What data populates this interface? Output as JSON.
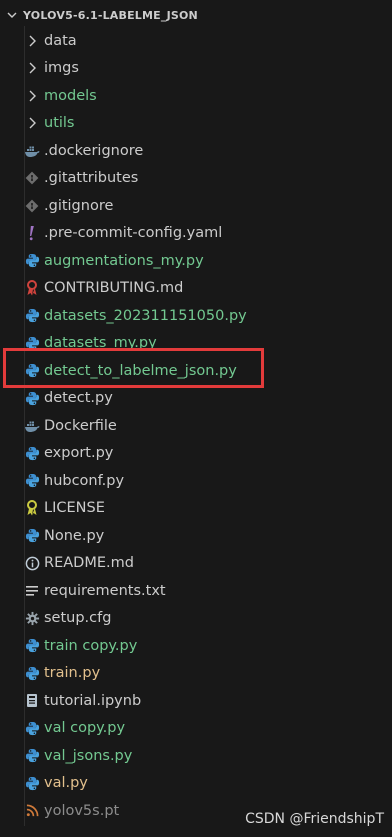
{
  "explorer": {
    "title": "YOLOV5-6.1-LABELME_JSON",
    "items": [
      {
        "label": "data",
        "type": "folder",
        "color": "#cccccc",
        "icon": "chevron-right-icon"
      },
      {
        "label": "imgs",
        "type": "folder",
        "color": "#cccccc",
        "icon": "chevron-right-icon"
      },
      {
        "label": "models",
        "type": "folder",
        "color": "#73c991",
        "icon": "chevron-right-icon"
      },
      {
        "label": "utils",
        "type": "folder",
        "color": "#73c991",
        "icon": "chevron-right-icon"
      },
      {
        "label": ".dockerignore",
        "type": "file",
        "color": "#cccccc",
        "icon": "docker-icon"
      },
      {
        "label": ".gitattributes",
        "type": "file",
        "color": "#cccccc",
        "icon": "git-icon"
      },
      {
        "label": ".gitignore",
        "type": "file",
        "color": "#cccccc",
        "icon": "git-icon"
      },
      {
        "label": ".pre-commit-config.yaml",
        "type": "file",
        "color": "#cccccc",
        "icon": "exclamation-icon"
      },
      {
        "label": "augmentations_my.py",
        "type": "file",
        "color": "#73c991",
        "icon": "python-icon"
      },
      {
        "label": "CONTRIBUTING.md",
        "type": "file",
        "color": "#cccccc",
        "icon": "ribbon-icon"
      },
      {
        "label": "datasets_202311151050.py",
        "type": "file",
        "color": "#73c991",
        "icon": "python-icon"
      },
      {
        "label": "datasets_my.py",
        "type": "file",
        "color": "#73c991",
        "icon": "python-icon"
      },
      {
        "label": "detect_to_labelme_json.py",
        "type": "file",
        "color": "#73c991",
        "icon": "python-icon",
        "highlighted": true
      },
      {
        "label": "detect.py",
        "type": "file",
        "color": "#cccccc",
        "icon": "python-icon"
      },
      {
        "label": "Dockerfile",
        "type": "file",
        "color": "#cccccc",
        "icon": "docker-icon"
      },
      {
        "label": "export.py",
        "type": "file",
        "color": "#cccccc",
        "icon": "python-icon"
      },
      {
        "label": "hubconf.py",
        "type": "file",
        "color": "#cccccc",
        "icon": "python-icon"
      },
      {
        "label": "LICENSE",
        "type": "file",
        "color": "#cccccc",
        "icon": "license-icon"
      },
      {
        "label": "None.py",
        "type": "file",
        "color": "#cccccc",
        "icon": "python-icon"
      },
      {
        "label": "README.md",
        "type": "file",
        "color": "#cccccc",
        "icon": "info-icon"
      },
      {
        "label": "requirements.txt",
        "type": "file",
        "color": "#cccccc",
        "icon": "lines-icon"
      },
      {
        "label": "setup.cfg",
        "type": "file",
        "color": "#cccccc",
        "icon": "gear-icon"
      },
      {
        "label": "train copy.py",
        "type": "file",
        "color": "#73c991",
        "icon": "python-icon"
      },
      {
        "label": "train.py",
        "type": "file",
        "color": "#e2c08d",
        "icon": "python-icon"
      },
      {
        "label": "tutorial.ipynb",
        "type": "file",
        "color": "#cccccc",
        "icon": "notebook-icon"
      },
      {
        "label": "val copy.py",
        "type": "file",
        "color": "#73c991",
        "icon": "python-icon"
      },
      {
        "label": "val_jsons.py",
        "type": "file",
        "color": "#73c991",
        "icon": "python-icon"
      },
      {
        "label": "val.py",
        "type": "file",
        "color": "#e2c08d",
        "icon": "python-icon"
      },
      {
        "label": "yolov5s.pt",
        "type": "file",
        "color": "#8c8c8c",
        "icon": "rss-icon"
      }
    ]
  },
  "watermark": "CSDN @FriendshipT"
}
